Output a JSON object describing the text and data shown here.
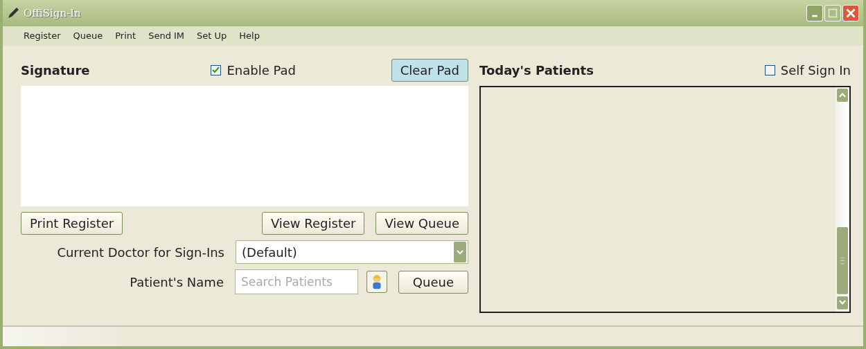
{
  "window": {
    "title": "OffiSign-In"
  },
  "menu": [
    "Register",
    "Queue",
    "Print",
    "Send IM",
    "Set Up",
    "Help"
  ],
  "signature": {
    "title": "Signature",
    "enable_pad": {
      "label": "Enable Pad",
      "checked": true
    },
    "clear_button": "Clear Pad"
  },
  "buttons": [
    "Print Register",
    "View Register",
    "View Queue"
  ],
  "doctor": {
    "label": "Current Doctor for Sign-Ins",
    "value": "(Default)"
  },
  "patient": {
    "label": "Patient's Name",
    "placeholder": "Search Patients",
    "queue_button": "Queue"
  },
  "patients_panel": {
    "title": "Today's Patients",
    "self_sign_in": {
      "label": "Self Sign In",
      "checked": false
    }
  }
}
